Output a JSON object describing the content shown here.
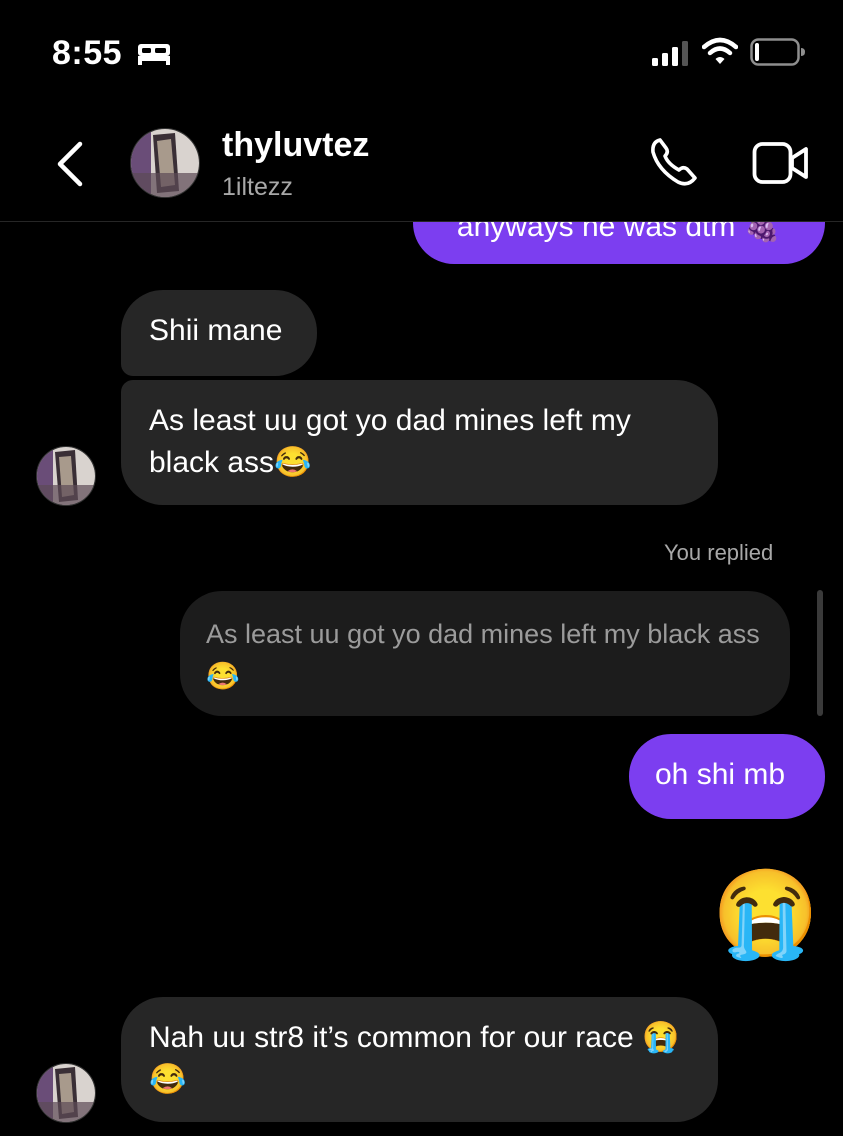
{
  "status_bar": {
    "time": "8:55",
    "icons": [
      "bed-icon",
      "signal-icon",
      "wifi-icon",
      "battery-icon"
    ]
  },
  "header": {
    "username": "thyluvtez",
    "handle": "1iltezz",
    "icons": [
      "chevron-left-icon",
      "phone-icon",
      "video-camera-icon"
    ]
  },
  "messages": {
    "partial_sent": "anyways he was dtm 🍇",
    "recv_1": "Shii mane",
    "recv_2": "As least uu got yo dad mines left my black ass😂",
    "replied_label": "You replied",
    "reply_quote": "As least uu got yo dad mines left my black ass😂",
    "sent_reply": "oh shi mb",
    "sent_emoji": "😭",
    "recv_3": "Nah uu str8 it’s common for our race 😭😂"
  },
  "colors": {
    "sent_bubble": "#7c3ef0",
    "received_bubble": "#262626",
    "background": "#000000",
    "meta_text": "#a8a8a8"
  }
}
